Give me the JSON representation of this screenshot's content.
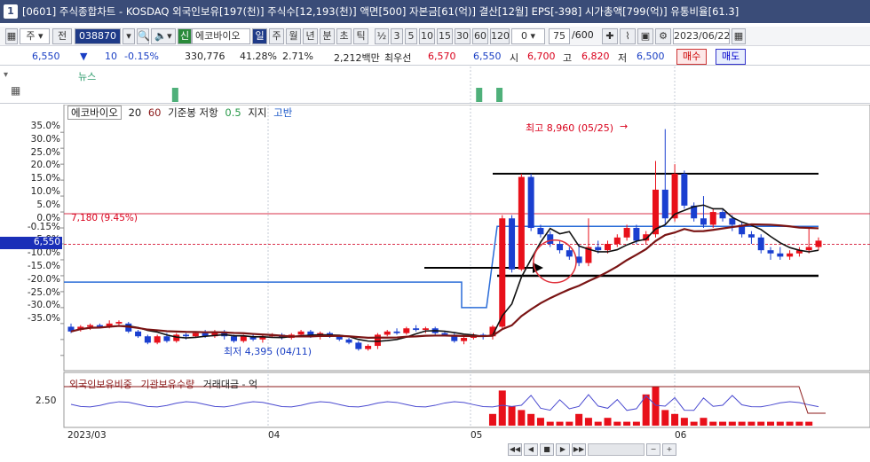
{
  "window": {
    "number": "1",
    "title": "[0601] 주식종합차트 - KOSDAQ 외국인보유[197(천)] 주식수[12,193(천)] 액면[500] 자본금[61(억)] 결산[12월] EPS[-398] 시가총액[799(억)] 유통비율[61.3]"
  },
  "toolbar": {
    "period_select": "주",
    "prev_label": "전",
    "code": "038870",
    "badge": "신",
    "name": "에코바이오",
    "periods": [
      "일",
      "주",
      "월",
      "년",
      "분",
      "초",
      "틱"
    ],
    "fraction": "½",
    "minutes": [
      "3",
      "5",
      "10",
      "15",
      "30",
      "60",
      "120"
    ],
    "spin_value": "0",
    "count": "75",
    "count_total": "/600",
    "date": "2023/06/22"
  },
  "quote": {
    "price": "6,550",
    "change": "10",
    "change_pct": "-0.15%",
    "volume": "330,776",
    "volume_ratio": "41.28%",
    "turnover": "2.71%",
    "amount": "2,212백만",
    "best_label": "최우선",
    "ask": "6,570",
    "bid": "6,550",
    "open_label": "시",
    "open": "6,700",
    "high_label": "고",
    "high": "6,820",
    "low_label": "저",
    "low": "6,500",
    "buy_label": "매수",
    "sell_label": "매도"
  },
  "news": {
    "label": "뉴스",
    "bars": [
      0,
      0,
      0,
      0,
      0,
      0,
      0,
      0,
      0,
      0,
      0,
      0,
      0,
      0,
      0,
      0,
      0,
      0,
      0,
      0,
      0,
      1,
      0,
      0,
      0,
      0,
      0,
      0,
      0,
      0,
      0,
      0,
      0,
      0,
      0,
      0,
      0,
      0,
      0,
      0,
      0,
      0,
      0,
      0,
      0,
      0,
      0,
      0,
      0,
      0,
      0,
      0,
      0,
      0,
      0,
      0,
      0,
      0,
      0,
      0,
      0,
      0,
      0,
      0,
      0,
      0,
      0,
      0,
      0,
      0,
      0,
      0,
      0,
      0,
      0,
      0,
      0,
      0,
      0,
      0,
      0,
      1,
      0,
      0,
      0,
      1,
      0,
      0,
      0,
      0,
      0,
      0,
      0,
      0,
      0,
      0,
      0,
      0,
      0,
      0,
      0,
      0,
      0,
      0,
      0,
      0,
      0,
      0,
      0,
      0,
      0,
      0,
      0,
      0,
      0,
      0,
      0,
      0,
      0,
      0,
      0,
      0,
      0,
      0,
      0,
      0,
      0,
      0,
      0,
      0,
      0,
      0,
      0,
      0,
      0,
      0,
      0,
      0,
      0,
      0,
      0,
      0,
      0,
      0,
      0,
      0,
      0,
      0,
      0,
      0
    ]
  },
  "legend": {
    "name": "에코바이오",
    "ma20": "20",
    "ma60": "60",
    "ref": "기준봉 저항",
    "ref_val": "0.5",
    "support": "지지",
    "high": "고반"
  },
  "annotations": {
    "high_label": "최고 8,960 (05/25)",
    "low_label": "최저 4,395 (04/11)",
    "ref_line_label": "7,180 (9.45%)",
    "current_price_tag": "6,550"
  },
  "y_axis": {
    "labels": [
      "35.0%",
      "30.0%",
      "25.0%",
      "20.0%",
      "15.0%",
      "10.0%",
      "5.0%",
      "0.0%",
      "-0.15%",
      "-5.0%",
      "-10.0%",
      "-15.0%",
      "-20.0%",
      "-25.0%",
      "-30.0%",
      "-35.0%"
    ]
  },
  "sub_legend": {
    "a": "외국인보유비중",
    "b": "기관보유수량",
    "c": "거래대금 - 억",
    "y_label": "2.50"
  },
  "x_axis": {
    "labels": [
      "2023/03",
      "04",
      "05",
      "06"
    ]
  },
  "chart_data": {
    "type": "candlestick",
    "y_unit": "%",
    "ylim": [
      -37,
      37
    ],
    "candles": [
      {
        "o": -26,
        "c": -27.5,
        "h": -25,
        "l": -28
      },
      {
        "o": -27,
        "c": -26,
        "h": -25.5,
        "l": -27.5
      },
      {
        "o": -26,
        "c": -25.5,
        "h": -25,
        "l": -27
      },
      {
        "o": -25.5,
        "c": -26,
        "h": -25,
        "l": -26.5
      },
      {
        "o": -26,
        "c": -25,
        "h": -24,
        "l": -26.5
      },
      {
        "o": -25,
        "c": -24.5,
        "h": -24,
        "l": -26
      },
      {
        "o": -25,
        "c": -27.5,
        "h": -24.5,
        "l": -28
      },
      {
        "o": -27.5,
        "c": -29,
        "h": -27,
        "l": -29.5
      },
      {
        "o": -29,
        "c": -31,
        "h": -28.5,
        "l": -31.5
      },
      {
        "o": -31,
        "c": -29,
        "h": -28.5,
        "l": -31.5
      },
      {
        "o": -29,
        "c": -30.5,
        "h": -28,
        "l": -31
      },
      {
        "o": -30.5,
        "c": -28.5,
        "h": -28,
        "l": -31
      },
      {
        "o": -28.5,
        "c": -29,
        "h": -28,
        "l": -30
      },
      {
        "o": -29,
        "c": -28,
        "h": -27.5,
        "l": -29.5
      },
      {
        "o": -28,
        "c": -29,
        "h": -27,
        "l": -29.5
      },
      {
        "o": -29,
        "c": -27.5,
        "h": -27,
        "l": -29.5
      },
      {
        "o": -27.5,
        "c": -29,
        "h": -27,
        "l": -30
      },
      {
        "o": -29,
        "c": -30.5,
        "h": -28.5,
        "l": -31
      },
      {
        "o": -30.5,
        "c": -29,
        "h": -28.5,
        "l": -31
      },
      {
        "o": -29,
        "c": -30,
        "h": -28.5,
        "l": -30.5
      },
      {
        "o": -30,
        "c": -29,
        "h": -28.5,
        "l": -31
      },
      {
        "o": -29,
        "c": -28.5,
        "h": -28,
        "l": -29.5
      },
      {
        "o": -28.5,
        "c": -29.5,
        "h": -28,
        "l": -30
      },
      {
        "o": -29.5,
        "c": -28.5,
        "h": -28,
        "l": -30
      },
      {
        "o": -28.5,
        "c": -27.5,
        "h": -27,
        "l": -29
      },
      {
        "o": -27.5,
        "c": -29,
        "h": -27,
        "l": -29.5
      },
      {
        "o": -29,
        "c": -28,
        "h": -27.5,
        "l": -30
      },
      {
        "o": -28,
        "c": -29,
        "h": -27.5,
        "l": -29.5
      },
      {
        "o": -29,
        "c": -30,
        "h": -28.5,
        "l": -30.5
      },
      {
        "o": -30,
        "c": -31,
        "h": -29.5,
        "l": -31.5
      },
      {
        "o": -31,
        "c": -33,
        "h": -30.5,
        "l": -33.5
      },
      {
        "o": -33,
        "c": -32,
        "h": -31.5,
        "l": -33.5
      },
      {
        "o": -32,
        "c": -28.5,
        "h": -28,
        "l": -33
      },
      {
        "o": -28.5,
        "c": -27.5,
        "h": -27,
        "l": -29
      },
      {
        "o": -27.5,
        "c": -28,
        "h": -26.5,
        "l": -28.5
      },
      {
        "o": -28,
        "c": -26.5,
        "h": -26,
        "l": -28.5
      },
      {
        "o": -26.5,
        "c": -27,
        "h": -25.5,
        "l": -27.5
      },
      {
        "o": -27,
        "c": -26.5,
        "h": -26,
        "l": -28
      },
      {
        "o": -26.5,
        "c": -28,
        "h": -26,
        "l": -28.5
      },
      {
        "o": -28,
        "c": -28.5,
        "h": -27.5,
        "l": -29
      },
      {
        "o": -28.5,
        "c": -30.5,
        "h": -28,
        "l": -31
      },
      {
        "o": -30.5,
        "c": -29.5,
        "h": -29,
        "l": -31.5
      },
      {
        "o": -29.5,
        "c": -28.5,
        "h": -28,
        "l": -30
      },
      {
        "o": -28.5,
        "c": -29,
        "h": -28,
        "l": -30
      },
      {
        "o": -29,
        "c": -26,
        "h": -25.5,
        "l": -30
      },
      {
        "o": -26,
        "c": 8,
        "h": 9,
        "l": -26.5
      },
      {
        "o": 8,
        "c": -8,
        "h": 9,
        "l": -9
      },
      {
        "o": -8,
        "c": 21,
        "h": 22,
        "l": -8.5
      },
      {
        "o": 21,
        "c": 5,
        "h": 22,
        "l": 4
      },
      {
        "o": 5,
        "c": 3,
        "h": 6,
        "l": 2
      },
      {
        "o": 3,
        "c": 0,
        "h": 4,
        "l": -1
      },
      {
        "o": 0,
        "c": -2,
        "h": 1,
        "l": -3
      },
      {
        "o": -2,
        "c": -4,
        "h": -1,
        "l": -5
      },
      {
        "o": -4,
        "c": -6,
        "h": 0,
        "l": -7
      },
      {
        "o": -6,
        "c": -1,
        "h": 8,
        "l": -7
      },
      {
        "o": -1,
        "c": -2,
        "h": 1,
        "l": -3
      },
      {
        "o": -2,
        "c": 0,
        "h": 1,
        "l": -3
      },
      {
        "o": 0,
        "c": 2,
        "h": 3,
        "l": -1
      },
      {
        "o": 2,
        "c": 5,
        "h": 6,
        "l": 1
      },
      {
        "o": 5,
        "c": 1,
        "h": 6,
        "l": 0
      },
      {
        "o": 1,
        "c": 3,
        "h": 4,
        "l": 0
      },
      {
        "o": 3,
        "c": 17,
        "h": 26,
        "l": 2
      },
      {
        "o": 17,
        "c": 8,
        "h": 36,
        "l": 6
      },
      {
        "o": 8,
        "c": 22,
        "h": 25,
        "l": 7
      },
      {
        "o": 22,
        "c": 12,
        "h": 23,
        "l": 11
      },
      {
        "o": 12,
        "c": 8,
        "h": 13,
        "l": 7
      },
      {
        "o": 8,
        "c": 6,
        "h": 15,
        "l": 5
      },
      {
        "o": 6,
        "c": 10,
        "h": 11,
        "l": 5
      },
      {
        "o": 10,
        "c": 8,
        "h": 11,
        "l": 7
      },
      {
        "o": 8,
        "c": 6,
        "h": 9,
        "l": 4
      },
      {
        "o": 6,
        "c": 3,
        "h": 7,
        "l": 2
      },
      {
        "o": 3,
        "c": 2,
        "h": 4,
        "l": 0
      },
      {
        "o": 2,
        "c": -2,
        "h": 3,
        "l": -3
      },
      {
        "o": -2,
        "c": -3,
        "h": -1,
        "l": -5
      },
      {
        "o": -3,
        "c": -4,
        "h": -1,
        "l": -5
      },
      {
        "o": -4,
        "c": -3,
        "h": -2,
        "l": -5
      },
      {
        "o": -3,
        "c": -2,
        "h": -1,
        "l": -4
      },
      {
        "o": -2,
        "c": -1,
        "h": 5,
        "l": -3
      },
      {
        "o": -1,
        "c": 1,
        "h": 2,
        "l": -2
      }
    ],
    "sub_volume": [
      0,
      0,
      0,
      0,
      0,
      0,
      0,
      0,
      0,
      0,
      0,
      0,
      0,
      0,
      0,
      0,
      0,
      0,
      0,
      0,
      0,
      0,
      0,
      0,
      0,
      0,
      0,
      0,
      0,
      0,
      0,
      0,
      0,
      0,
      0,
      0,
      0,
      0,
      0,
      0,
      0,
      0,
      0,
      0,
      0.3,
      0.9,
      0.5,
      0.4,
      0.3,
      0.2,
      0.1,
      0.1,
      0.1,
      0.3,
      0.2,
      0.1,
      0.2,
      0.1,
      0.1,
      0.1,
      0.8,
      1.0,
      0.4,
      0.3,
      0.2,
      0.1,
      0.2,
      0.1,
      0.1,
      0.1,
      0.1,
      0.1,
      0.1,
      0.1,
      0.1,
      0.1,
      0.1,
      0.1
    ]
  }
}
